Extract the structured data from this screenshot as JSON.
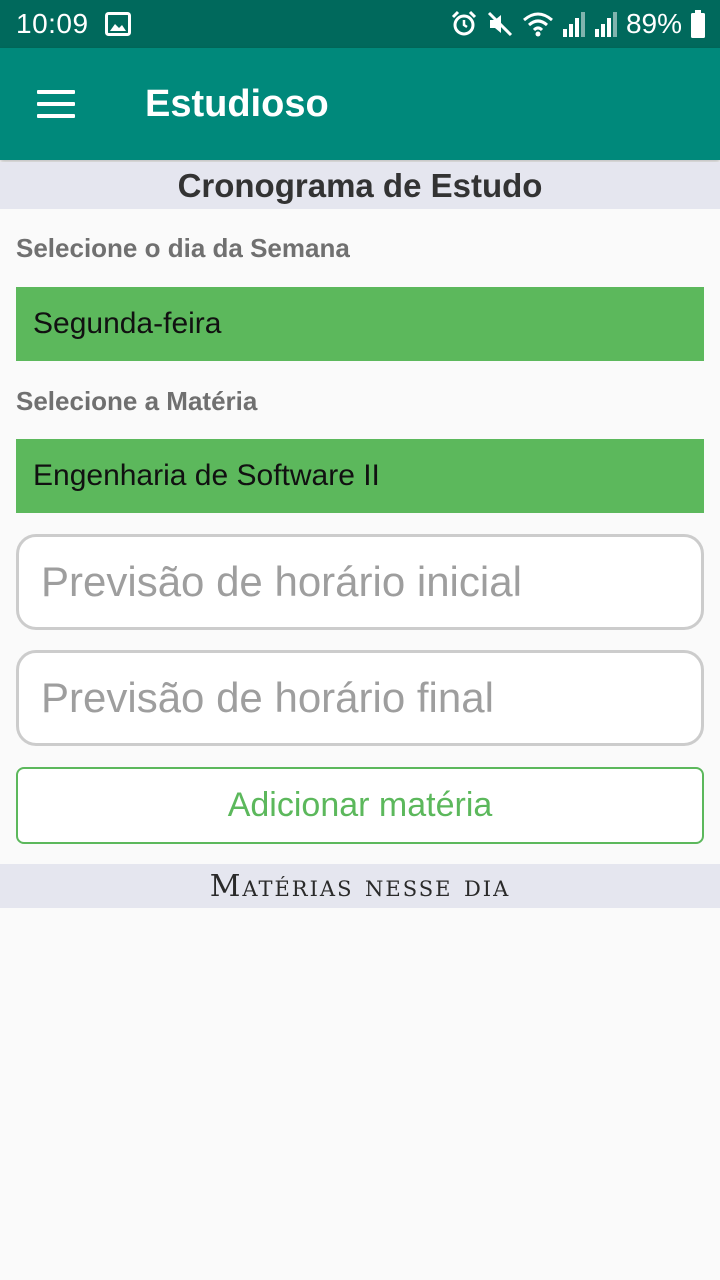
{
  "status_bar": {
    "time": "10:09",
    "battery": "89%",
    "icons": [
      "image-icon",
      "alarm-icon",
      "mute-icon",
      "wifi-icon",
      "signal-icon",
      "signal-icon",
      "battery-icon"
    ]
  },
  "app_bar": {
    "title": "Estudioso",
    "menu_icon": "menu-icon"
  },
  "main": {
    "header": "Cronograma de Estudo",
    "day_label": "Selecione o dia da Semana",
    "day_value": "Segunda-feira",
    "subject_label": "Selecione a Matéria",
    "subject_value": "Engenharia de Software II",
    "start_time_placeholder": "Previsão de horário inicial",
    "end_time_placeholder": "Previsão de horário final",
    "add_button_label": "Adicionar matéria",
    "list_header": "Matérias nesse dia"
  },
  "colors": {
    "status_bar": "#00695c",
    "app_bar": "#00897b",
    "accent_green": "#5cb85c",
    "section_bg": "#e5e6ef"
  }
}
